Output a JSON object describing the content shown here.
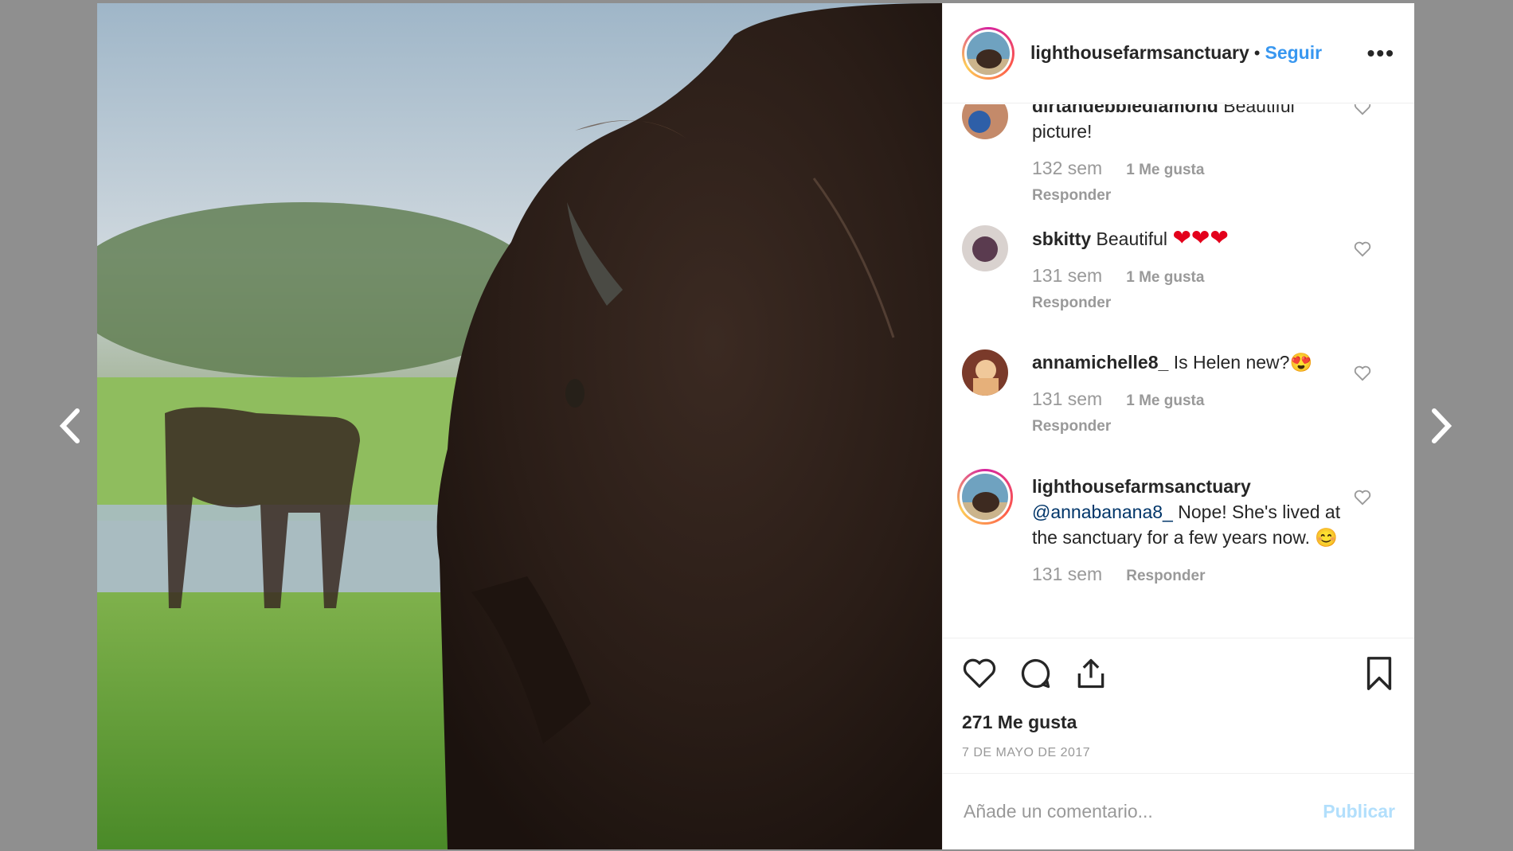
{
  "post": {
    "username": "lighthousefarmsanctuary",
    "separator": "•",
    "follow_label": "Seguir",
    "more_label": "•••"
  },
  "comments": [
    {
      "username": "dirtandebbiediamond",
      "text": "Beautiful picture!",
      "time": "132 sem",
      "likes": "1 Me gusta",
      "reply": "Responder"
    },
    {
      "username": "sbkitty",
      "text": "Beautiful",
      "hearts": "❤❤❤",
      "time": "131 sem",
      "likes": "1 Me gusta",
      "reply": "Responder"
    },
    {
      "username": "annamichelle8_",
      "text": "Is Helen new?",
      "emoji": "😍",
      "time": "131 sem",
      "likes": "1 Me gusta",
      "reply": "Responder"
    },
    {
      "username": "lighthousefarmsanctuary",
      "mention": "@annabanana8_",
      "text": "Nope! She's lived at the sanctuary for a few years now.",
      "emoji": "😊",
      "time": "131 sem",
      "reply": "Responder"
    }
  ],
  "actions": {
    "likes_count": "271 Me gusta",
    "date": "7 DE MAYO DE 2017"
  },
  "add_comment": {
    "placeholder": "Añade un comentario...",
    "publish_label": "Publicar"
  },
  "colors": {
    "follow": "#3897f0",
    "publish_disabled": "#b2dffc",
    "meta": "#999999"
  }
}
